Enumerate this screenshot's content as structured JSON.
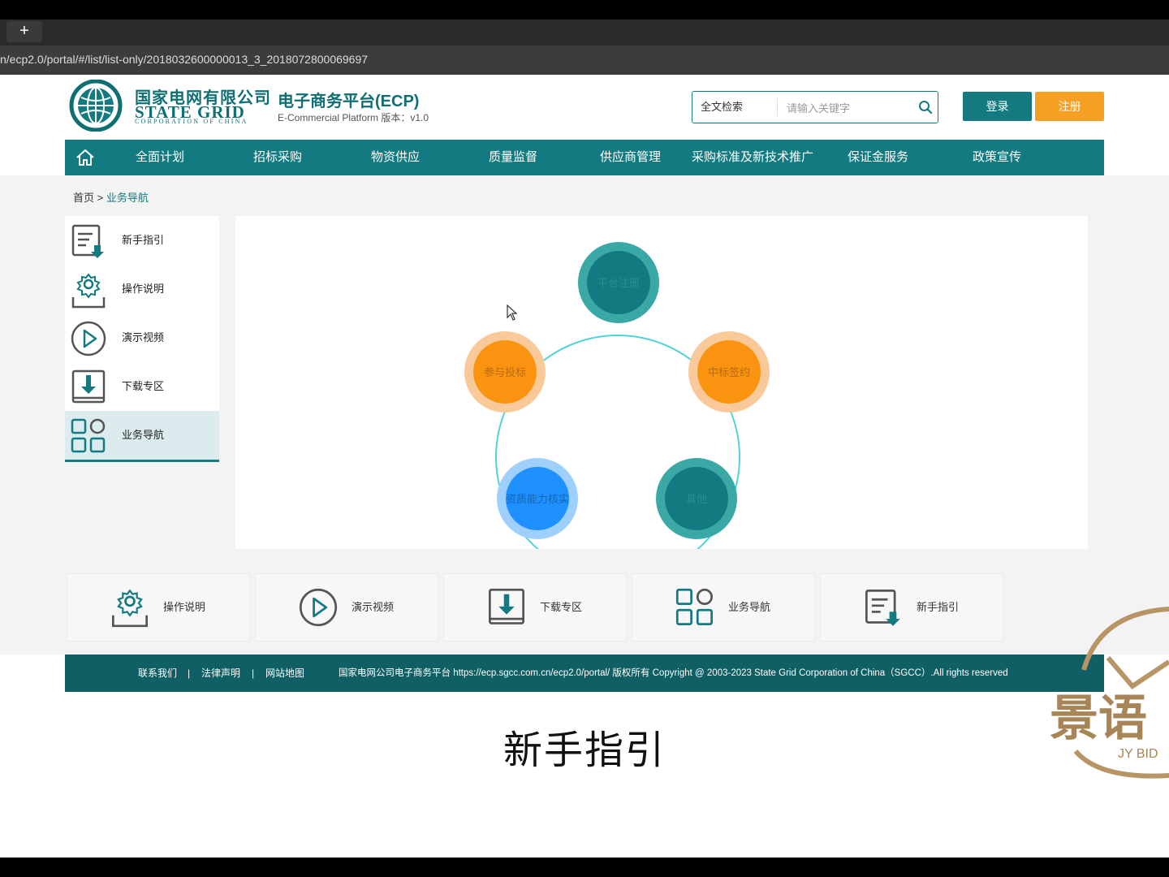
{
  "browser": {
    "new_tab": "+",
    "url": "n/ecp2.0/portal/#/list/list-only/2018032600000013_3_2018072800069697"
  },
  "header": {
    "brand_cn": "国家电网有限公司",
    "brand_en": "STATE GRID",
    "brand_en_sub": "CORPORATION OF CHINA",
    "platform_cn": "电子商务平台(ECP)",
    "platform_en": "E-Commercial Platform 版本：v1.0",
    "search_scope": "全文检索",
    "search_placeholder": "请输入关键字",
    "login": "登录",
    "register": "注册"
  },
  "nav": [
    "全面计划",
    "招标采购",
    "物资供应",
    "质量监督",
    "供应商管理",
    "采购标准及新技术推广",
    "保证金服务",
    "政策宣传"
  ],
  "breadcrumb": {
    "home": "首页",
    "sep": " > ",
    "current": "业务导航"
  },
  "sidebar": [
    "新手指引",
    "操作说明",
    "演示视频",
    "下载专区",
    "业务导航"
  ],
  "diagram": {
    "nodes": [
      "平台注册",
      "中标签约",
      "其他",
      "资质能力核实",
      "参与投标"
    ],
    "colors": {
      "teal": "#127a80",
      "teal_ring": "#3aa9a6",
      "orange": "#fa9410",
      "orange_ring": "#f9c99a",
      "blue": "#1e90ff",
      "blue_ring": "#9fd0fb",
      "circle": "#4fd3d8"
    }
  },
  "cards": [
    "操作说明",
    "演示视频",
    "下载专区",
    "业务导航",
    "新手指引"
  ],
  "footer": {
    "contact": "联系我们",
    "legal": "法律声明",
    "sitemap": "网站地图",
    "sep": "|",
    "copyright": "国家电网公司电子商务平台 https://ecp.sgcc.com.cn/ecp2.0/portal/ 版权所有 Copyright @ 2003-2023 State Grid Corporation of China（SGCC）.All rights reserved"
  },
  "subtitle": "新手指引",
  "watermark": {
    "cn": "景语",
    "en": "JY BID"
  }
}
